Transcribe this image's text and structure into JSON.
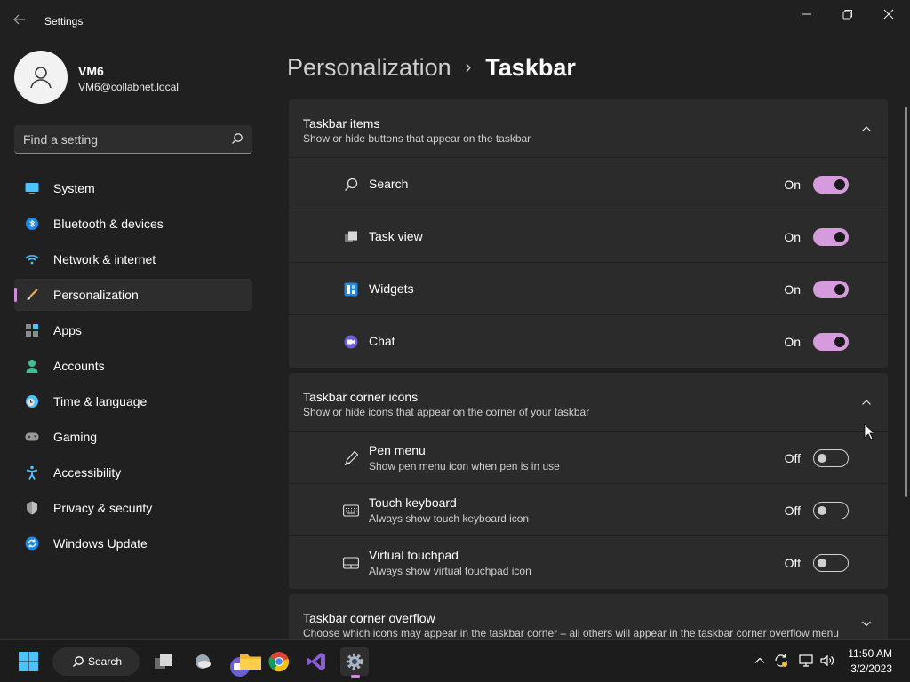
{
  "window": {
    "title": "Settings"
  },
  "user": {
    "name": "VM6",
    "email": "VM6@collabnet.local"
  },
  "search": {
    "placeholder": "Find a setting"
  },
  "sidebar": {
    "items": [
      {
        "label": "System",
        "icon": "monitor-icon"
      },
      {
        "label": "Bluetooth & devices",
        "icon": "bluetooth-icon"
      },
      {
        "label": "Network & internet",
        "icon": "wifi-icon"
      },
      {
        "label": "Personalization",
        "icon": "paintbrush-icon",
        "active": true
      },
      {
        "label": "Apps",
        "icon": "apps-icon"
      },
      {
        "label": "Accounts",
        "icon": "person-icon"
      },
      {
        "label": "Time & language",
        "icon": "clock-globe-icon"
      },
      {
        "label": "Gaming",
        "icon": "gamepad-icon"
      },
      {
        "label": "Accessibility",
        "icon": "accessibility-icon"
      },
      {
        "label": "Privacy & security",
        "icon": "shield-icon"
      },
      {
        "label": "Windows Update",
        "icon": "update-icon"
      }
    ]
  },
  "header": {
    "parent": "Personalization",
    "separator": "›",
    "current": "Taskbar"
  },
  "sections": {
    "items": {
      "title": "Taskbar items",
      "desc": "Show or hide buttons that appear on the taskbar",
      "rows": [
        {
          "label": "Search",
          "state": "On",
          "icon": "search-icon"
        },
        {
          "label": "Task view",
          "state": "On",
          "icon": "task-view-icon"
        },
        {
          "label": "Widgets",
          "state": "On",
          "icon": "widgets-icon"
        },
        {
          "label": "Chat",
          "state": "On",
          "icon": "chat-icon"
        }
      ]
    },
    "corner": {
      "title": "Taskbar corner icons",
      "desc": "Show or hide icons that appear on the corner of your taskbar",
      "rows": [
        {
          "label": "Pen menu",
          "sub": "Show pen menu icon when pen is in use",
          "state": "Off",
          "icon": "pen-icon"
        },
        {
          "label": "Touch keyboard",
          "sub": "Always show touch keyboard icon",
          "state": "Off",
          "icon": "keyboard-icon"
        },
        {
          "label": "Virtual touchpad",
          "sub": "Always show virtual touchpad icon",
          "state": "Off",
          "icon": "touchpad-icon"
        }
      ]
    },
    "overflow": {
      "title": "Taskbar corner overflow",
      "desc": "Choose which icons may appear in the taskbar corner – all others will appear in the taskbar corner overflow menu"
    }
  },
  "taskbar": {
    "search_label": "Search",
    "time": "11:50 AM",
    "date": "3/2/2023"
  },
  "colors": {
    "accent": "#d59bdc",
    "background": "#202020",
    "card": "#2b2b2b"
  }
}
